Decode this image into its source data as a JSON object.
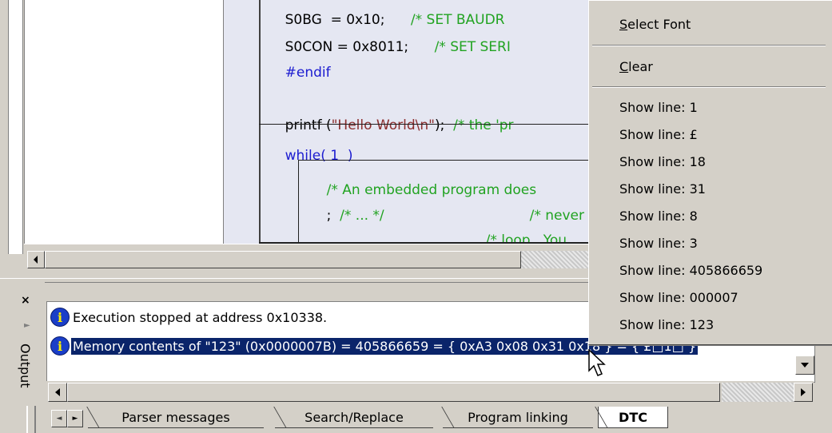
{
  "editor": {
    "code_lines": [
      {
        "text": "S0BG  = 0x10;",
        "comment": "/* SET BAUDR"
      },
      {
        "text": "S0CON = 0x8011;",
        "comment": "/* SET SERI"
      },
      {
        "text": "#endif"
      },
      {
        "text": "printf (",
        "string": "\"Hello World\\n\"",
        "tail": ");",
        "comment": "/* the 'pr"
      },
      {
        "text": "while( 1  )"
      },
      {
        "comment": "/* An embedded program does"
      },
      {
        "text": ";",
        "comment": "/* ... */",
        "comment2": "/* never re"
      },
      {
        "comment": "/* loop.  You"
      }
    ]
  },
  "context_menu": {
    "select_font": "Select Font",
    "select_font_accel": "S",
    "select_font_rest": "elect Font",
    "clear": "Clear",
    "clear_accel": "C",
    "clear_rest": "lear",
    "show_lines": [
      "Show line: 1",
      "Show line: £",
      "Show line: 18",
      "Show line: 31",
      "Show line: 8",
      "Show line: 3",
      "Show line: 405866659",
      "Show line: 000007",
      "Show line: 123"
    ]
  },
  "output": {
    "panel_title": "Output",
    "close_glyph": "×",
    "messages": [
      {
        "icon": "info-icon",
        "text": "Execution stopped at address 0x10338."
      },
      {
        "icon": "info-icon",
        "text": "Memory contents of \"123\" (0x0000007B) = 405866659 = { 0xA3 0x08 0x31 0x18 } = { £□1□ }",
        "selected": true
      }
    ],
    "tabs": [
      "Parser messages",
      "Search/Replace",
      "Program linking",
      "DTC"
    ],
    "active_tab": "DTC"
  }
}
